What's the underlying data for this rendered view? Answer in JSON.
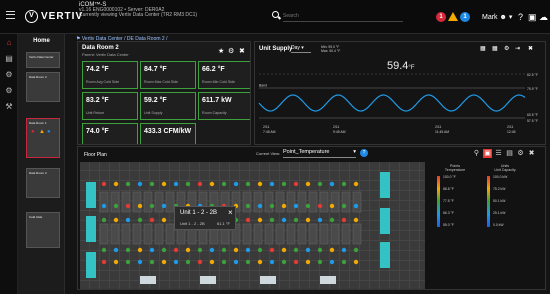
{
  "header": {
    "brand": "VERTIV",
    "logo_letter": "V",
    "product_name": "iCOM™-S",
    "product_sub": "v1.16 ENG0000102 • Server: DER0A2",
    "product_line3": "Currently viewing Vertiv Data Center (TR2 RM3 DC1)",
    "search_placeholder": "Search",
    "alarm_red_count": "1",
    "alarm_blue_count": "1",
    "user_name": "Mark",
    "help_glyph": "?",
    "icons": [
      "hamburger-menu-icon",
      "vertiv-logo-icon",
      "search-icon",
      "critical-alarm-icon",
      "warning-alarm-icon",
      "info-alarm-icon",
      "user-icon",
      "help-icon",
      "bookmark-icon",
      "cloud-upload-icon"
    ]
  },
  "nav": {
    "icons": [
      "home-icon",
      "dashboard-icon",
      "settings-icon",
      "gear-icon",
      "wrench-icon"
    ]
  },
  "home": {
    "label": "Home",
    "tiles": [
      "Vertiv Data Center",
      "Data Room 2",
      "Data Room 1",
      "Cold Aisle"
    ]
  },
  "breadcrumb": "⚑ Vertiv Data Center  /  DE Data Room 2  /",
  "data_room": {
    "title": "Data Room 2",
    "subtitle": "Parent: Vertiv Data Center",
    "tiles": [
      {
        "value": "74.2 °F",
        "label": "Room Avg Cold Side"
      },
      {
        "value": "84.7 °F",
        "label": "Room Max Cold Side"
      },
      {
        "value": "66.2 °F",
        "label": "Room Min Cold Side"
      },
      {
        "value": "83.2 °F",
        "label": "Unit Return"
      },
      {
        "value": "59.2 °F",
        "label": "Unit Supply"
      },
      {
        "value": "611.7 kW",
        "label": "Room Capacity"
      },
      {
        "value": "74.0 °F",
        "label": ""
      },
      {
        "value": "433.3 CFM/kW",
        "label": ""
      }
    ]
  },
  "unit_supply": {
    "title": "Unit Supply",
    "range": "Day",
    "min_label": "Min:",
    "min_value": "59.0 °F",
    "max_label": "Max:",
    "max_value": "60.4 °F",
    "current_value": "59.4",
    "unit": "°F",
    "max_mark": "82.5 °F",
    "upper_mark": "75.9 °F",
    "lower_mark": "60.5 °F",
    "min_mark": "57.5 °F",
    "band_label": "Band",
    "x_ticks": [
      {
        "date": "2/11",
        "time": "7:45 AM"
      },
      {
        "date": "2/11",
        "time": "9:45 AM"
      },
      {
        "date": "2/11",
        "time": "11:45 AM"
      },
      {
        "date": "2/11",
        "time": "12:45"
      }
    ]
  },
  "floor_plan": {
    "title": "Floor Plan",
    "current_view_label": "Current View:",
    "current_view": "Point_Temperature",
    "legend_a": {
      "title": "Points",
      "subtitle": "Temperature",
      "values": [
        "100.0 °F",
        "88.8 °F",
        "77.5 °F",
        "66.3 °F",
        "55.0 °F"
      ]
    },
    "legend_b": {
      "title": "Units",
      "subtitle": "Unit Capacity",
      "values": [
        "100.0 kW",
        "75.2 kW",
        "50.1 kW",
        "25.1 kW",
        "0.0 kW"
      ]
    },
    "popup": {
      "title": "Unit 1 - 2 - 2B",
      "close": "×",
      "row_label": "Unit 1 - 2 - 2B",
      "row_value": "61.1 °F"
    }
  },
  "colors": {
    "accent_red": "#d7283b",
    "ok_green": "#3ca03c",
    "wave": "#1e9be8",
    "warn": "#f2a900",
    "info": "#1e88e5"
  }
}
